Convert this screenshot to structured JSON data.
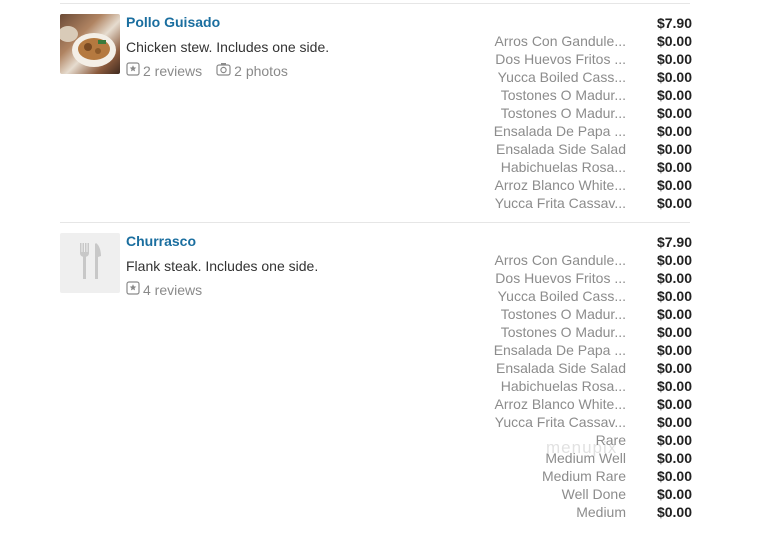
{
  "items": [
    {
      "name": "Pollo Guisado",
      "description": "Chicken stew. Includes one side.",
      "reviews": "2 reviews",
      "photos": "2 photos",
      "base_price": "$7.90",
      "options": [
        {
          "label": "Arros Con Gandule...",
          "price": "$0.00"
        },
        {
          "label": "Dos Huevos Fritos ...",
          "price": "$0.00"
        },
        {
          "label": "Yucca Boiled Cass...",
          "price": "$0.00"
        },
        {
          "label": "Tostones O Madur...",
          "price": "$0.00"
        },
        {
          "label": "Tostones O Madur...",
          "price": "$0.00"
        },
        {
          "label": "Ensalada De Papa ...",
          "price": "$0.00"
        },
        {
          "label": "Ensalada Side Salad",
          "price": "$0.00"
        },
        {
          "label": "Habichuelas Rosa...",
          "price": "$0.00"
        },
        {
          "label": "Arroz Blanco White...",
          "price": "$0.00"
        },
        {
          "label": "Yucca Frita Cassav...",
          "price": "$0.00"
        }
      ]
    },
    {
      "name": "Churrasco",
      "description": "Flank steak. Includes one side.",
      "reviews": "4 reviews",
      "base_price": "$7.90",
      "options": [
        {
          "label": "Arros Con Gandule...",
          "price": "$0.00"
        },
        {
          "label": "Dos Huevos Fritos ...",
          "price": "$0.00"
        },
        {
          "label": "Yucca Boiled Cass...",
          "price": "$0.00"
        },
        {
          "label": "Tostones O Madur...",
          "price": "$0.00"
        },
        {
          "label": "Tostones O Madur...",
          "price": "$0.00"
        },
        {
          "label": "Ensalada De Papa ...",
          "price": "$0.00"
        },
        {
          "label": "Ensalada Side Salad",
          "price": "$0.00"
        },
        {
          "label": "Habichuelas Rosa...",
          "price": "$0.00"
        },
        {
          "label": "Arroz Blanco White...",
          "price": "$0.00"
        },
        {
          "label": "Yucca Frita Cassav...",
          "price": "$0.00"
        },
        {
          "label": "Rare",
          "price": "$0.00"
        },
        {
          "label": "Medium Well",
          "price": "$0.00"
        },
        {
          "label": "Medium Rare",
          "price": "$0.00"
        },
        {
          "label": "Well Done",
          "price": "$0.00"
        },
        {
          "label": "Medium",
          "price": "$0.00"
        }
      ]
    }
  ],
  "watermark": "menupix",
  "icons": {
    "review": "star-square-icon",
    "photo": "camera-icon",
    "placeholder": "fork-knife-icon"
  }
}
